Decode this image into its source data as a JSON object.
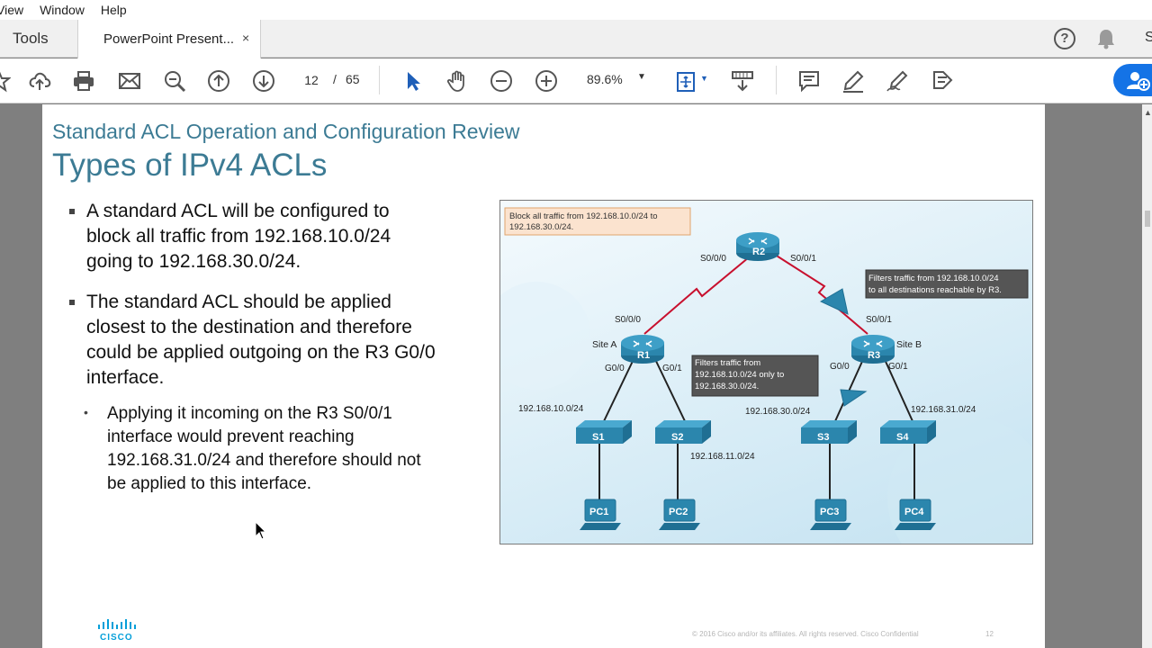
{
  "menubar": {
    "items": [
      "View",
      "Window",
      "Help"
    ]
  },
  "tabs": {
    "tools": "Tools",
    "document": "PowerPoint Present...",
    "close": "×"
  },
  "header_right": {
    "user_initial": "S"
  },
  "toolbar": {
    "page_current": "12",
    "page_sep": "/",
    "page_total": "65",
    "zoom": "89.6%"
  },
  "slide": {
    "subtitle": "Standard ACL Operation and Configuration Review",
    "title": "Types of IPv4 ACLs",
    "bullets": [
      [
        "A standard ACL will be configured to",
        "block all traffic from 192.168.10.0/24",
        "going to 192.168.30.0/24."
      ],
      [
        "The standard ACL should be applied",
        "closest to the destination and therefore",
        "could be applied outgoing on the R3 G0/0",
        "interface."
      ]
    ],
    "sub_bullets": [
      [
        "Applying it incoming on the R3 S0/0/1",
        "interface would prevent reaching",
        "192.168.31.0/24 and therefore should not",
        "be applied to this interface."
      ]
    ],
    "footer": {
      "logo_text": "CISCO",
      "copyright": "© 2016  Cisco and/or its affiliates. All rights reserved.   Cisco Confidential",
      "page_number": "12"
    }
  },
  "diagram": {
    "callout_block": [
      "Block all traffic from 192.168.10.0/24 to",
      "192.168.30.0/24."
    ],
    "callout_r3": [
      "Filters traffic from 192.168.10.0/24",
      "to all destinations reachable by R3."
    ],
    "callout_mid": [
      "Filters traffic from",
      "192.168.10.0/24 only to",
      "192.168.30.0/24."
    ],
    "routers": {
      "r1": "R1",
      "r2": "R2",
      "r3": "R3"
    },
    "switches": {
      "s1": "S1",
      "s2": "S2",
      "s3": "S3",
      "s4": "S4"
    },
    "pcs": {
      "pc1": "PC1",
      "pc2": "PC2",
      "pc3": "PC3",
      "pc4": "PC4"
    },
    "sites": {
      "a": "Site A",
      "b": "Site B"
    },
    "interfaces": {
      "r2_left": "S0/0/0",
      "r2_right": "S0/0/1",
      "r1_serial": "S0/0/0",
      "r1_g0": "G0/0",
      "r1_g1": "G0/1",
      "r3_serial": "S0/0/1",
      "r3_g0": "G0/0",
      "r3_g1": "G0/1"
    },
    "networks": {
      "n10": "192.168.10.0/24",
      "n11": "192.168.11.0/24",
      "n30": "192.168.30.0/24",
      "n31": "192.168.31.0/24"
    }
  }
}
